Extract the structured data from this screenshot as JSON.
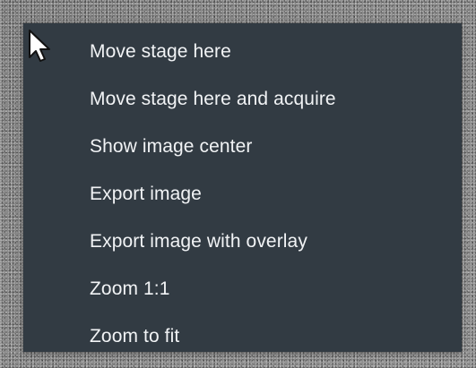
{
  "context_menu": {
    "items": [
      {
        "label": "Move stage here"
      },
      {
        "label": "Move stage here and acquire"
      },
      {
        "label": "Show image center"
      },
      {
        "label": "Export image"
      },
      {
        "label": "Export image with overlay"
      },
      {
        "label": "Zoom 1:1"
      },
      {
        "label": "Zoom to fit"
      }
    ]
  },
  "icons": {
    "pointer": "mouse-pointer-icon"
  },
  "colors": {
    "menu_background": "#323b43",
    "menu_text": "#f1f3f5",
    "background_noise": "#8f8f8f"
  }
}
